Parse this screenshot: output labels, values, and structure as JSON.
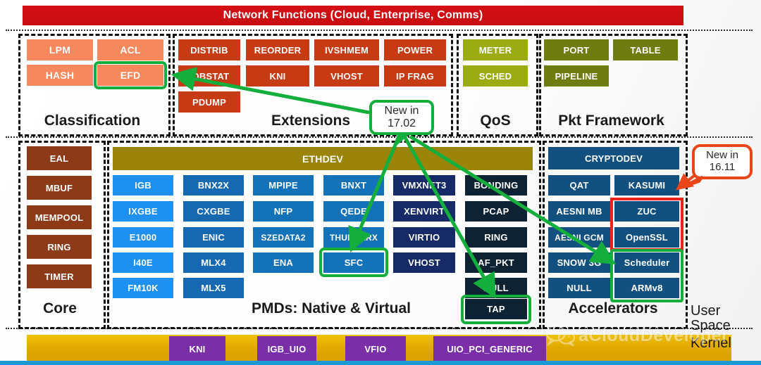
{
  "title": "Network Functions (Cloud, Enterprise, Comms)",
  "colors": {
    "title_bar": "#d40f15",
    "classification": "#f5885c",
    "extensions": "#c63b14",
    "core": "#8c3a18",
    "qos": "#9aac12",
    "pkt_framework": "#6f7c10",
    "ethdev": "#9a8409",
    "pmd_native": "#1e90f0",
    "pmd_virtual": "#152a66",
    "accelerators": "#12507f",
    "kernel_bar": "#e0a800",
    "kernel_modules": "#7a2fa8",
    "highlight_green": "#14ae3c",
    "highlight_red": "#ef2019"
  },
  "groups": {
    "classification": {
      "label": "Classification",
      "rows": [
        [
          "LPM",
          "ACL"
        ],
        [
          "HASH",
          "EFD"
        ]
      ],
      "highlighted": [
        "EFD"
      ]
    },
    "extensions": {
      "label": "Extensions",
      "rows": [
        [
          "DISTRIB",
          "REORDER",
          "IVSHMEM",
          "POWER"
        ],
        [
          "IOBSTAT",
          "KNI",
          "VHOST",
          "IP FRAG"
        ],
        [
          "PDUMP"
        ]
      ],
      "highlighted": []
    },
    "qos": {
      "label": "QoS",
      "rows": [
        [
          "METER"
        ],
        [
          "SCHED"
        ]
      ]
    },
    "pkt_framework": {
      "label": "Pkt Framework",
      "rows": [
        [
          "PORT",
          "TABLE"
        ],
        [
          "PIPELINE"
        ]
      ]
    },
    "core": {
      "label": "Core",
      "items": [
        "EAL",
        "MBUF",
        "MEMPOOL",
        "RING",
        "TIMER"
      ]
    },
    "pmds": {
      "label": "PMDs: Native & Virtual",
      "header": "ETHDEV",
      "columns": [
        [
          "IGB",
          "IXGBE",
          "E1000",
          "I40E",
          "FM10K"
        ],
        [
          "BNX2X",
          "CXGBE",
          "ENIC",
          "MLX4",
          "MLX5"
        ],
        [
          "MPIPE",
          "NFP",
          "SZEDATA2",
          "ENA"
        ],
        [
          "BNXT",
          "QEDE",
          "THUNDERX",
          "SFC"
        ],
        [
          "VMXNET3",
          "XENVIRT",
          "VIRTIO",
          "VHOST"
        ],
        [
          "BONDING",
          "PCAP",
          "RING",
          "AF_PKT",
          "NULL",
          "TAP"
        ]
      ],
      "highlighted": [
        "SFC",
        "TAP"
      ]
    },
    "accelerators": {
      "label": "Accelerators",
      "header": "CRYPTODEV",
      "rows": [
        [
          "QAT",
          "KASUMI"
        ],
        [
          "AESNI MB",
          "ZUC"
        ],
        [
          "AESNI GCM",
          "OpenSSL"
        ],
        [
          "SNOW 3G",
          "Scheduler"
        ],
        [
          "NULL",
          "ARMv8"
        ]
      ],
      "highlighted_green": [
        "Scheduler",
        "ARMv8"
      ],
      "highlighted_red": [
        "ZUC",
        "OpenSSL"
      ]
    },
    "kernel": {
      "modules": [
        "KNI",
        "IGB_UIO",
        "VFIO",
        "UIO_PCI_GENERIC"
      ]
    }
  },
  "callouts": {
    "new_17": {
      "line1": "New in",
      "line2": "17.02",
      "color": "#14ae3c"
    },
    "new_16": {
      "line1": "New in",
      "line2": "16.11",
      "color": "#e8451a"
    }
  },
  "side_labels": {
    "user_space_line1": "User",
    "user_space_line2": "Space",
    "kernel": "Kernel"
  },
  "watermark": {
    "text": "aCloudDeveloper",
    "icon": "wechat-icon"
  }
}
